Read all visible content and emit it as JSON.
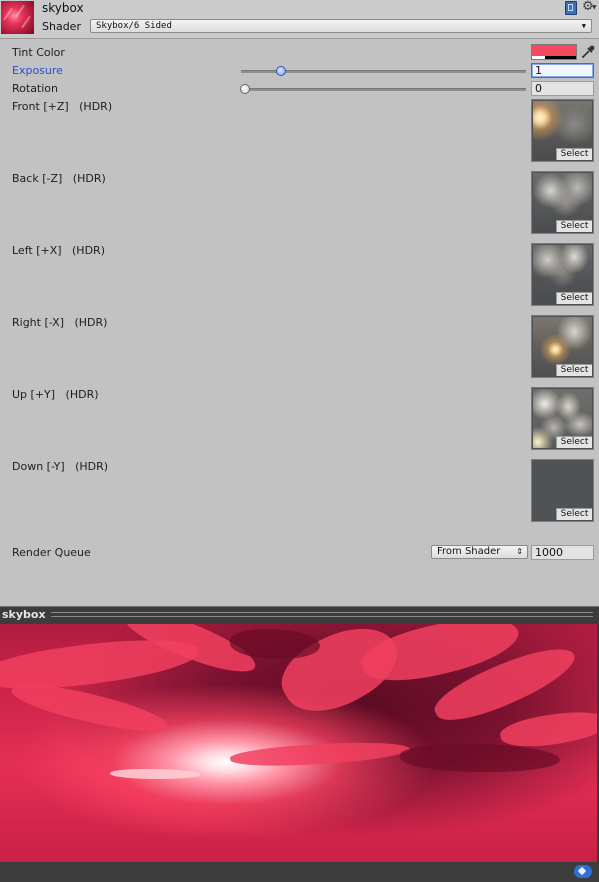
{
  "header": {
    "material_name": "skybox",
    "shader_label": "Shader",
    "shader_value": "Skybox/6 Sided",
    "icons": [
      "book-icon",
      "gear-icon"
    ]
  },
  "properties": {
    "tint_color": {
      "label": "Tint Color",
      "color": "#f5495f"
    },
    "exposure": {
      "label": "Exposure",
      "value": "1",
      "slider_fraction": 0.14
    },
    "rotation": {
      "label": "Rotation",
      "value": "0",
      "slider_fraction": 0.0
    },
    "textures": [
      {
        "label": "Front [+Z]   (HDR)",
        "button": "Select"
      },
      {
        "label": "Back [-Z]   (HDR)",
        "button": "Select"
      },
      {
        "label": "Left [+X]   (HDR)",
        "button": "Select"
      },
      {
        "label": "Right [-X]   (HDR)",
        "button": "Select"
      },
      {
        "label": "Up [+Y]   (HDR)",
        "button": "Select"
      },
      {
        "label": "Down [-Y]   (HDR)",
        "button": "Select"
      }
    ],
    "render_queue": {
      "label": "Render Queue",
      "mode": "From Shader",
      "value": "1000"
    }
  },
  "preview": {
    "title": "skybox"
  },
  "colors": {
    "accent": "#2b4cd0",
    "tint": "#f5495f",
    "preview_sky": "#d1284c"
  }
}
